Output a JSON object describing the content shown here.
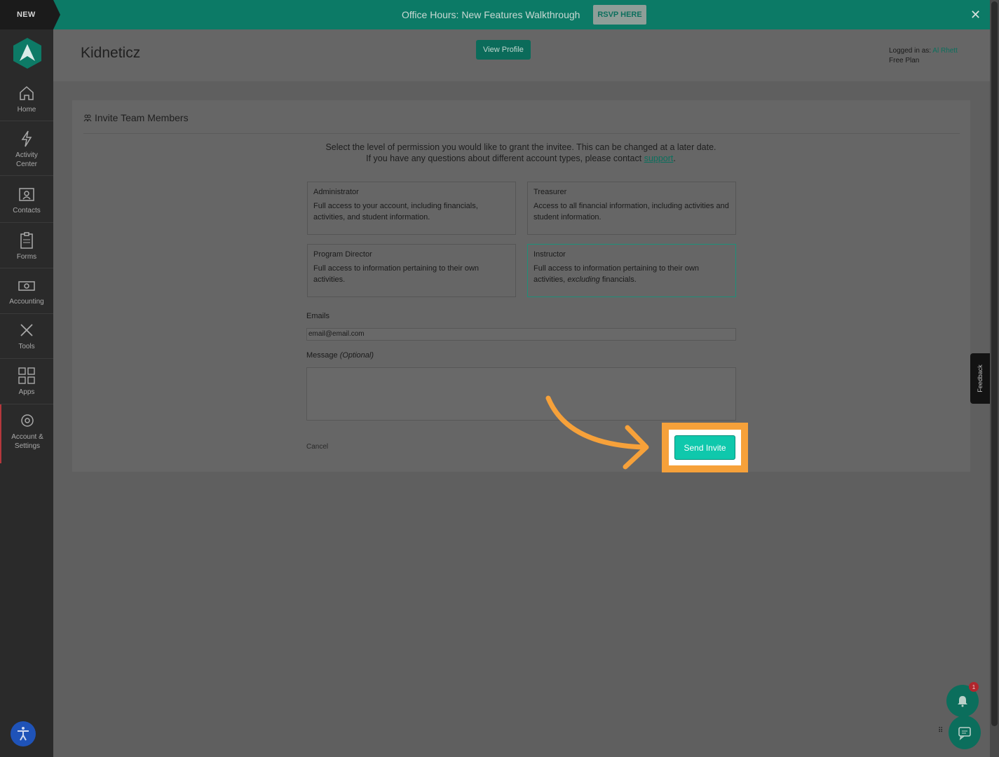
{
  "banner": {
    "new_label": "NEW",
    "text": "Office Hours: New Features Walkthrough",
    "rsvp_label": "RSVP HERE",
    "close_icon": "close-icon",
    "color": "#0c7a66"
  },
  "sidebar": {
    "items": [
      {
        "label": "Home",
        "icon": "home-icon"
      },
      {
        "label": "Activity\nCenter",
        "icon": "lightning-icon"
      },
      {
        "label": "Contacts",
        "icon": "contacts-icon"
      },
      {
        "label": "Forms",
        "icon": "clipboard-icon"
      },
      {
        "label": "Accounting",
        "icon": "money-icon"
      },
      {
        "label": "Tools",
        "icon": "tools-icon"
      },
      {
        "label": "Apps",
        "icon": "apps-grid-icon"
      },
      {
        "label": "Account &\nSettings",
        "icon": "gear-icon",
        "active": true
      }
    ]
  },
  "header": {
    "org_name": "Kidneticz",
    "view_profile_label": "View Profile",
    "logged_in_prefix": "Logged in as:",
    "user_name": "Al Rhett",
    "plan": "Free Plan"
  },
  "invite": {
    "title": "Invite Team Members",
    "intro_line1": "Select the level of permission you would like to grant the invitee. This can be changed at a later date.",
    "intro_line2_prefix": "If you have any questions about different account types, please contact",
    "support_link": "support",
    "intro_line2_suffix": ".",
    "roles": [
      {
        "title": "Administrator",
        "desc": "Full access to your account, including financials, activities, and student information."
      },
      {
        "title": "Treasurer",
        "desc": "Access to all financial information, including activities and student information."
      },
      {
        "title": "Program Director",
        "desc": "Full access to information pertaining to their own activities."
      },
      {
        "title": "Instructor",
        "desc_prefix": "Full access to information pertaining to their own activities,",
        "desc_em": "excluding",
        "desc_suffix": "financials.",
        "selected": true
      }
    ],
    "emails_label": "Emails",
    "emails_value": "email@email.com",
    "message_label": "Message",
    "message_optional": "(Optional)",
    "message_value": "",
    "cancel_label": "Cancel",
    "send_label": "Send Invite"
  },
  "feedback_label": "Feedback",
  "notifications": {
    "badge_count": "1"
  },
  "colors": {
    "accent": "#0fc8ac",
    "highlight": "#f6a13a",
    "brand": "#0b6e5c"
  }
}
